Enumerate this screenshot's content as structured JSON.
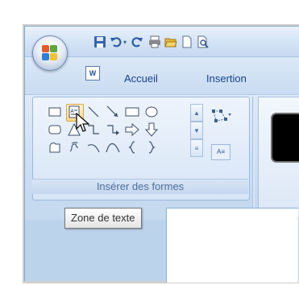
{
  "window": {
    "tabs": [
      {
        "label": "Accueil"
      },
      {
        "label": "Insertion"
      }
    ]
  },
  "ribbon": {
    "group_label": "Insérer des formes"
  },
  "tooltip": {
    "text": "Zone de texte"
  },
  "icons": {
    "office_button": "office-logo-icon",
    "quick_access": [
      "save-icon",
      "undo-icon",
      "redo-icon",
      "print-icon",
      "open-icon",
      "new-icon",
      "print-preview-icon"
    ]
  },
  "colors": {
    "ribbon_text": "#15428b",
    "group_label": "#4e6e9c",
    "selection": "#ffd98a"
  }
}
